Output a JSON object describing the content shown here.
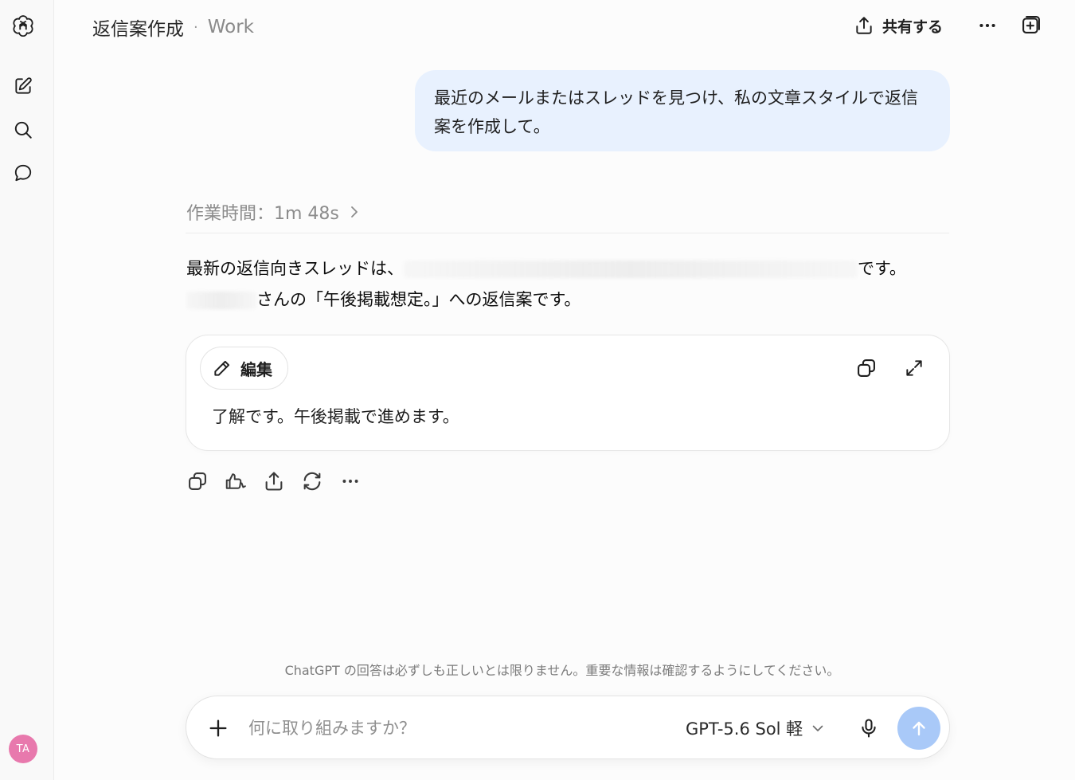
{
  "header": {
    "title": "返信案作成",
    "separator": "·",
    "project": "Work",
    "share_label": "共有する"
  },
  "sidebar": {
    "avatar_initials": "TA"
  },
  "conversation": {
    "user_message": "最近のメールまたはスレッドを見つけ、私の文章スタイルで返信案を作成して。",
    "work_time": "作業時間：1m 48s",
    "answer_line1_start": "最新の返信向きスレッドは、",
    "answer_line1_end": "です。",
    "answer_line2_end": "さんの「午後掲載想定。」への返信案です。"
  },
  "draft_card": {
    "edit_label": "編集",
    "text": "了解です。午後掲載で進めます。"
  },
  "disclaimer": "ChatGPT の回答は必ずしも正しいとは限りません。重要な情報は確認するようにしてください。",
  "composer": {
    "placeholder": "何に取り組みますか？",
    "value": "",
    "model_label": "GPT-5.6 Sol 軽"
  },
  "colors": {
    "user_bubble": "#e8f1fe",
    "send_button": "#a9c9f8",
    "avatar": "#e879ad"
  },
  "icons": [
    "openai-logo-icon",
    "new-chat-icon",
    "search-icon",
    "chats-icon",
    "share-icon",
    "more-icon",
    "temporary-chat-icon",
    "pencil-icon",
    "copy-icon",
    "expand-icon",
    "thumbs-icon",
    "refresh-icon",
    "plus-icon",
    "mic-icon",
    "arrow-up-icon",
    "chevron-right-icon",
    "chevron-down-icon"
  ]
}
